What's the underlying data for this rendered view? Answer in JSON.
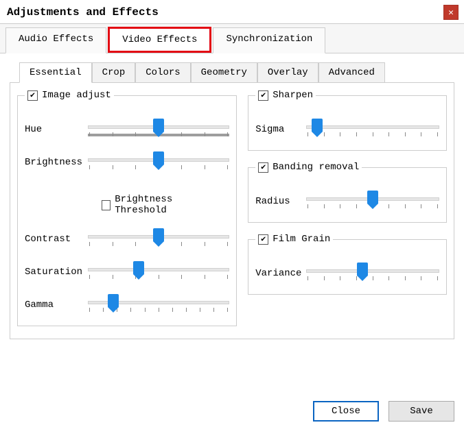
{
  "window": {
    "title": "Adjustments and Effects"
  },
  "main_tabs": {
    "audio": "Audio Effects",
    "video": "Video Effects",
    "sync": "Synchronization",
    "selected": "video"
  },
  "sub_tabs": {
    "essential": "Essential",
    "crop": "Crop",
    "colors": "Colors",
    "geometry": "Geometry",
    "overlay": "Overlay",
    "advanced": "Advanced",
    "selected": "essential"
  },
  "image_adjust": {
    "title": "Image adjust",
    "checked": true,
    "hue": {
      "label": "Hue",
      "pos": 50,
      "ticks": 7
    },
    "brightness": {
      "label": "Brightness",
      "pos": 50,
      "ticks": 7
    },
    "brightness_threshold": {
      "label": "Brightness Threshold",
      "checked": false
    },
    "contrast": {
      "label": "Contrast",
      "pos": 50,
      "ticks": 7
    },
    "saturation": {
      "label": "Saturation",
      "pos": 36,
      "ticks": 7
    },
    "gamma": {
      "label": "Gamma",
      "pos": 18,
      "ticks": 11
    }
  },
  "sharpen": {
    "title": "Sharpen",
    "checked": true,
    "sigma": {
      "label": "Sigma",
      "pos": 8,
      "ticks": 9
    }
  },
  "banding": {
    "title": "Banding removal",
    "checked": true,
    "radius": {
      "label": "Radius",
      "pos": 50,
      "ticks": 9
    }
  },
  "film_grain": {
    "title": "Film Grain",
    "checked": true,
    "variance": {
      "label": "Variance",
      "pos": 42,
      "ticks": 9
    }
  },
  "buttons": {
    "close": "Close",
    "save": "Save"
  }
}
